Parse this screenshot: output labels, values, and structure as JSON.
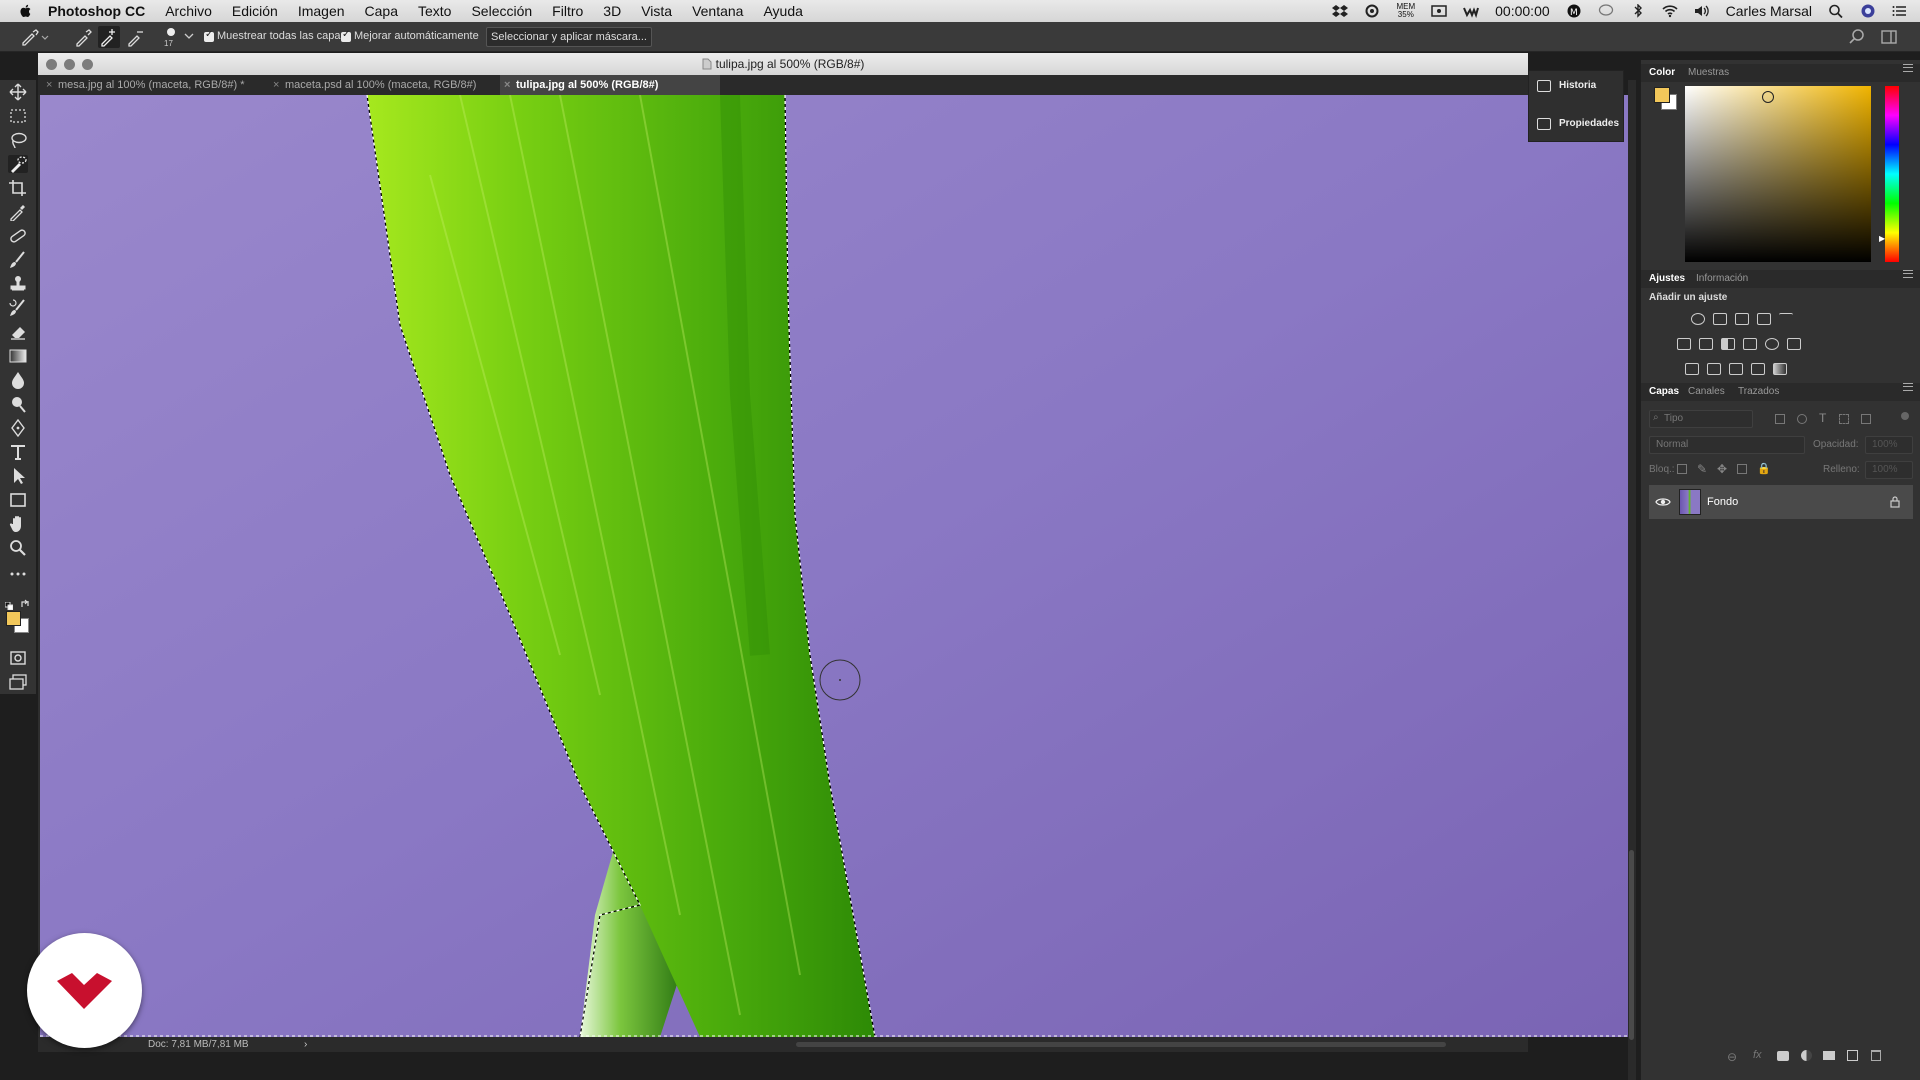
{
  "menubar": {
    "app": "Photoshop CC",
    "items": [
      "Archivo",
      "Edición",
      "Imagen",
      "Capa",
      "Texto",
      "Selección",
      "Filtro",
      "3D",
      "Vista",
      "Ventana",
      "Ayuda"
    ],
    "mem_label": "MEM",
    "mem_value": "35%",
    "clock": "00:00:00",
    "user": "Carles Marsal"
  },
  "options": {
    "brush_size": "17",
    "sample_all_layers": "Muestrear todas las capas",
    "auto_enhance": "Mejorar automáticamente",
    "select_and_mask": "Seleccionar y aplicar máscara..."
  },
  "document": {
    "title": "tulipa.jpg al 500% (RGB/8#)",
    "tabs": [
      {
        "label": "mesa.jpg al 100% (maceta, RGB/8#) *"
      },
      {
        "label": "maceta.psd al 100% (maceta, RGB/8#)"
      },
      {
        "label": "tulipa.jpg al 500% (RGB/8#)"
      }
    ],
    "status_doc": "Doc: 7,81 MB/7,81 MB",
    "zoom": "500%"
  },
  "minipanel": {
    "history": "Historia",
    "properties": "Propiedades"
  },
  "panels": {
    "color_tabs": [
      "Color",
      "Muestras"
    ],
    "adjust_tabs": [
      "Ajustes",
      "Información"
    ],
    "adjust_title": "Añadir un ajuste",
    "layers_tabs": [
      "Capas",
      "Canales",
      "Trazados"
    ],
    "layers_filter": "Tipo",
    "blend_mode": "Normal",
    "opacity_label": "Opacidad:",
    "opacity_value": "100%",
    "lock_label": "Bloq.:",
    "fill_label": "Relleno:",
    "fill_value": "100%",
    "layer_name": "Fondo"
  },
  "colors": {
    "foreground": "#f2c75a",
    "background": "#ffffff",
    "canvas_purple": "#8f7bc2",
    "stem_green": "#5bbf12",
    "brand_red": "#c8102e"
  }
}
